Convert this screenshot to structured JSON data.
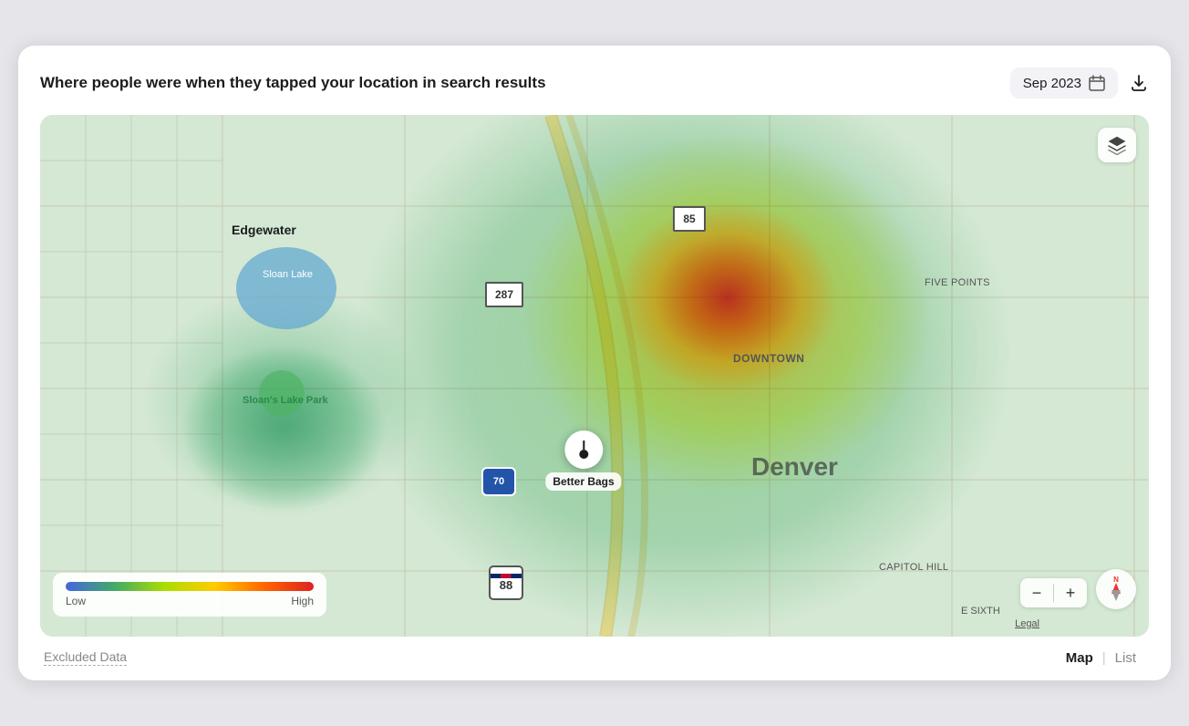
{
  "header": {
    "title": "Where people were when they tapped your location in search results",
    "date_label": "Sep 2023",
    "download_label": "Download"
  },
  "map": {
    "toggle_label": "Map",
    "location_name": "Better Bags",
    "labels": {
      "edgewater": "Edgewater",
      "sloan_lake": "Sloan\nLake",
      "sloans_lake_park": "Sloan's\nLake Park",
      "denver": "Denver",
      "downtown": "DOWNTOWN",
      "five_points": "FIVE POINTS",
      "capitol_hill": "CAPITOL HILL",
      "e_sixth": "E SIXTH",
      "legal": "Legal"
    },
    "highways": {
      "h85": "85",
      "h287": "287",
      "h70": "70",
      "h88": "88"
    },
    "legend": {
      "low": "Low",
      "high": "High"
    },
    "zoom": {
      "minus": "−",
      "plus": "+"
    }
  },
  "footer": {
    "excluded_data_label": "Excluded Data",
    "view_map_label": "Map",
    "view_list_label": "List"
  }
}
